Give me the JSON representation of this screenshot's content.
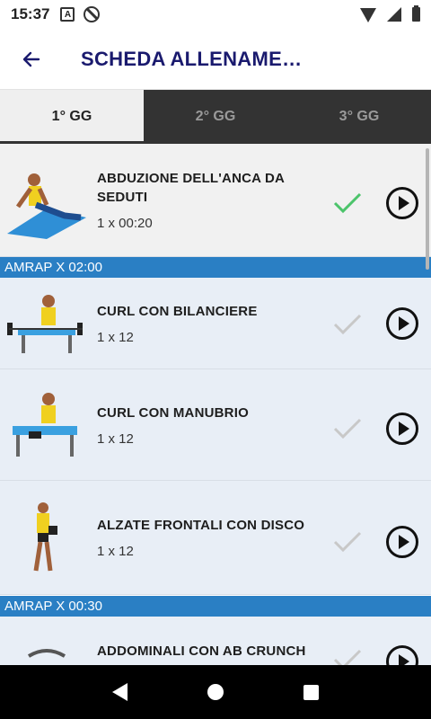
{
  "status_bar": {
    "time": "15:37",
    "icons": [
      "a-notification-icon",
      "blocked-icon",
      "wifi-icon",
      "signal-icon",
      "battery-icon"
    ]
  },
  "app_bar": {
    "title": "SCHEDA ALLENAME…",
    "back_icon": "arrow-left-icon",
    "title_color": "#1a1a6e"
  },
  "tabs": [
    {
      "label": "1° GG",
      "active": true
    },
    {
      "label": "2° GG",
      "active": false
    },
    {
      "label": "3° GG",
      "active": false
    }
  ],
  "colors": {
    "banner": "#2a7fc4",
    "check_done": "#4cc46b",
    "check_pending": "#c8c8c8",
    "tab_bar": "#333333"
  },
  "exercises": [
    {
      "name": "ABDUZIONE DELL'ANCA DA SEDUTI",
      "sets": "1 x 00:20",
      "done": true
    },
    {
      "name": "CURL CON BILANCIERE",
      "sets": "1 x 12",
      "done": false
    },
    {
      "name": "CURL CON MANUBRIO",
      "sets": "1 x 12",
      "done": false
    },
    {
      "name": "ALZATE FRONTALI CON DISCO",
      "sets": "1 x 12",
      "done": false
    },
    {
      "name": "ADDOMINALI CON AB CRUNCH",
      "sets": "",
      "done": false
    }
  ],
  "banners": [
    {
      "label": "AMRAP X 02:00"
    },
    {
      "label": "AMRAP X 00:30"
    }
  ]
}
